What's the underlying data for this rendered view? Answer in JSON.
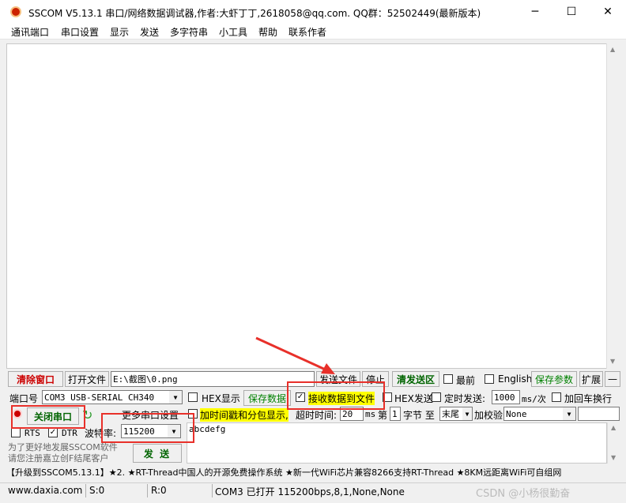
{
  "window": {
    "title": "SSCOM V5.13.1 串口/网络数据调试器,作者:大虾丁丁,2618058@qq.com. QQ群：52502449(最新版本)",
    "minimize": "─",
    "maximize": "☐",
    "close": "✕"
  },
  "menu": [
    "通讯端口",
    "串口设置",
    "显示",
    "发送",
    "多字符串",
    "小工具",
    "帮助",
    "联系作者"
  ],
  "toolbar": {
    "clear_window": "清除窗口",
    "open_file": "打开文件",
    "file_path": "E:\\截图\\0.png",
    "send_file": "发送文件",
    "stop": "停止",
    "clear_send": "清发送区",
    "top_most": "最前",
    "english": "English",
    "save_params": "保存参数",
    "expand": "扩展",
    "collapse": "—"
  },
  "port": {
    "port_label": "端口号",
    "port_value": "COM3 USB-SERIAL CH340",
    "hex_display": "HEX显示",
    "save_data": "保存数据",
    "recv_to_file": "接收数据到文件",
    "recv_to_file_checked": "✓",
    "hex_send": "HEX发送",
    "timed_send": "定时发送:",
    "interval": "1000",
    "interval_unit": "ms/次",
    "add_crlf": "加回车换行"
  },
  "row2": {
    "close_port": "关闭串口",
    "more_settings": "更多串口设置",
    "timestamp": "加时间戳和分包显示,",
    "timeout_label": "超时时间:",
    "timeout_value": "20",
    "ms": "ms",
    "nth_label": "第",
    "nth_value": "1",
    "byte_label": "字节 至",
    "end_value": "末尾",
    "checksum_label": "加校验",
    "checksum_value": "None"
  },
  "row3": {
    "rts": "RTS",
    "dtr": "DTR",
    "dtr_checked": "✓",
    "baud_label": "波特率:",
    "baud_value": "115200"
  },
  "send_text": "abcdefg",
  "send_button": "发  送",
  "promo_line1": "为了更好地发展SSCOM软件",
  "promo_line2": "请您注册嘉立创F结尾客户",
  "ticker": "【升级到SSCOM5.13.1】★2. ★RT-Thread中国人的开源免费操作系统 ★新一代WiFi芯片兼容8266支持RT-Thread ★8KM远距离WiFi可自组网",
  "status": {
    "site": "www.daxia.com",
    "s": "S:0",
    "r": "R:0",
    "port_status": "COM3 已打开  115200bps,8,1,None,None",
    "watermark": "CSDN @小杨很勤奋"
  },
  "colors": {
    "annotation": "#e8302a",
    "highlight": "#ffff00"
  }
}
